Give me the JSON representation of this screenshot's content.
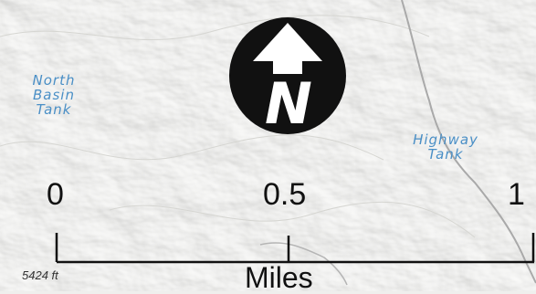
{
  "map": {
    "labels": {
      "north_basin_tank_line1": "North",
      "north_basin_tank_line2": "Basin",
      "north_basin_tank_line3": "Tank",
      "highway_tank_line1": "Highway",
      "highway_tank_line2": "Tank"
    },
    "elevation": "5424 ft",
    "colors": {
      "background": "#efefed",
      "water_label": "#4a8fc6",
      "road": "#a9a9a9",
      "north_arrow": "#111111"
    }
  },
  "scale_bar": {
    "ticks": [
      "0",
      "0.5",
      "1"
    ],
    "unit": "Miles"
  },
  "north_arrow": {
    "letter": "N",
    "icon": "north-arrow-icon"
  }
}
